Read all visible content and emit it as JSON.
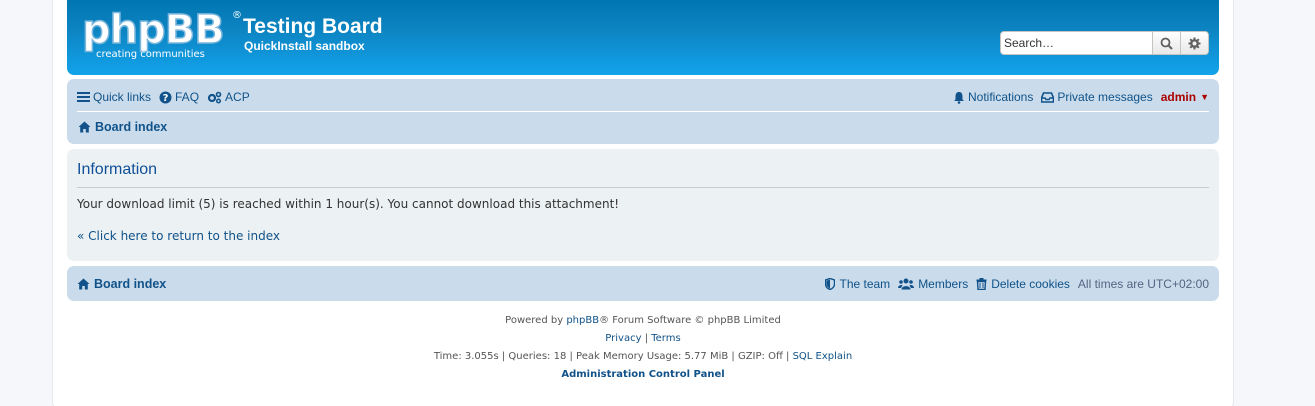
{
  "header": {
    "logo_text": "phpBB",
    "logo_reg": "®",
    "logo_tagline": "creating  communities",
    "site_title": "Testing Board",
    "site_description": "QuickInstall sandbox",
    "search_placeholder": "Search…"
  },
  "navbar": {
    "quick_links": "Quick links",
    "faq": "FAQ",
    "acp": "ACP",
    "notifications": "Notifications",
    "private_messages": "Private messages",
    "username": "admin",
    "breadcrumb": "Board index"
  },
  "panel": {
    "title": "Information",
    "message": "Your download limit (5) is reached within 1 hour(s). You cannot download this attachment!",
    "return_link": "« Click here to return to the index"
  },
  "footer": {
    "breadcrumb": "Board index",
    "the_team": "The team",
    "members": "Members",
    "delete_cookies": "Delete cookies",
    "timezone_prefix": "All times are",
    "timezone": "UTC+02:00",
    "powered_prefix": "Powered by",
    "powered_link": "phpBB",
    "powered_suffix": "® Forum Software © phpBB Limited",
    "privacy": "Privacy",
    "terms": "Terms",
    "separator": "|",
    "debug_stats": "Time: 3.055s | Queries: 18 | Peak Memory Usage: 5.77 MiB | GZIP: Off |",
    "sql_explain": "SQL Explain",
    "acp_link": "Administration Control Panel"
  },
  "colors": {
    "header_gradient_top": "#0076b1",
    "header_gradient_bottom": "#12a3eb",
    "navbar_bg": "#cadceb",
    "panel_bg": "#ecf1f3",
    "link": "#105289",
    "username": "#aa0000"
  }
}
